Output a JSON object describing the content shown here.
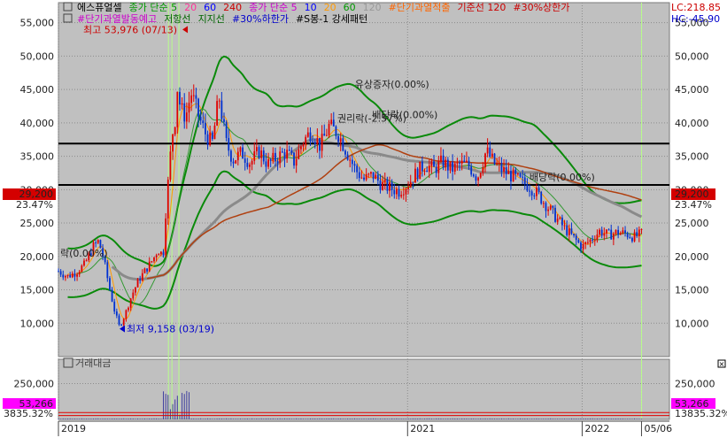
{
  "window": {
    "title": "에스퓨얼셀",
    "colors": {
      "plot_bg": "#c0c0c0",
      "axis_bg": "#ffffff",
      "grid": "#8c8c8c",
      "candle_up": "#e00000",
      "candle_down": "#0030d0"
    }
  },
  "legend": {
    "row1": [
      {
        "text": "에스퓨얼셀",
        "color": "#000000"
      },
      {
        "text": "종가 단순 5",
        "color": "#009900"
      },
      {
        "text": "20",
        "color": "#ff3399"
      },
      {
        "text": "60",
        "color": "#0000ff"
      },
      {
        "text": "240",
        "color": "#cc0000"
      },
      {
        "text": "종가 단순 5",
        "color": "#cc00cc"
      },
      {
        "text": "10",
        "color": "#0000ff"
      },
      {
        "text": "20",
        "color": "#ff9900"
      },
      {
        "text": "60",
        "color": "#009900"
      },
      {
        "text": "120",
        "color": "#999999"
      },
      {
        "text": "#단기과열적출",
        "color": "#ff6600"
      },
      {
        "text": "기준선 120",
        "color": "#cc0000"
      },
      {
        "text": "#30%상한가",
        "color": "#cc0000"
      }
    ],
    "row2": [
      {
        "text": "#단기과열발동예고",
        "color": "#cc00cc"
      },
      {
        "text": "저항선",
        "color": "#006600"
      },
      {
        "text": "지지선",
        "color": "#006600"
      },
      {
        "text": "#30%하한가",
        "color": "#0000cc"
      },
      {
        "text": "#S봉-1 강세패턴",
        "color": "#000000"
      }
    ]
  },
  "right_info": {
    "lc": "LC:218.85",
    "hc": "HC:-45.90"
  },
  "chart_data": {
    "type": "candlestick",
    "price_axis": {
      "ticks": [
        "55,000",
        "50,000",
        "45,000",
        "40,000",
        "35,000",
        "30,000",
        "25,000",
        "20,000",
        "15,000",
        "10,000"
      ],
      "tick_values": [
        55000,
        50000,
        45000,
        40000,
        35000,
        30000,
        25000,
        20000,
        15000,
        10000
      ],
      "ylim": [
        5000,
        58000
      ]
    },
    "current_price": {
      "label": "29,200",
      "value": 29200,
      "pct": "23.47%"
    },
    "horizontal_lines": [
      36900,
      30700
    ],
    "x_axis": {
      "labels": [
        {
          "text": "2019",
          "t": 0.0
        },
        {
          "text": "2021",
          "t": 2.0
        },
        {
          "text": "2022",
          "t": 3.0
        },
        {
          "text": "05/06",
          "t": 3.34
        }
      ],
      "range": [
        0.0,
        3.5
      ]
    },
    "markers": {
      "high": {
        "text": "최고 53,976 (07/13)",
        "value": 53976
      },
      "low": {
        "text": "최저 9,158 (03/19)",
        "value": 9158
      }
    },
    "annotations": [
      {
        "text": "유상증자(0.00%)",
        "t": 1.85,
        "value": 45300
      },
      {
        "text": "배당락(0.00%)",
        "t": 1.95,
        "value": 40700
      },
      {
        "text": "권리락(-2.57%)",
        "t": 1.75,
        "value": 40200
      },
      {
        "text": "배당락(0.00%)",
        "t": 2.85,
        "value": 31400
      },
      {
        "text": "락(0.00%)",
        "t": 0.0,
        "value": 20000
      }
    ],
    "close_series": [
      [
        0.0,
        17800
      ],
      [
        0.05,
        17000
      ],
      [
        0.1,
        17600
      ],
      [
        0.15,
        18800
      ],
      [
        0.2,
        21500
      ],
      [
        0.23,
        22300
      ],
      [
        0.26,
        19500
      ],
      [
        0.29,
        15500
      ],
      [
        0.32,
        12000
      ],
      [
        0.35,
        9400
      ],
      [
        0.38,
        11200
      ],
      [
        0.42,
        14200
      ],
      [
        0.46,
        16500
      ],
      [
        0.5,
        18000
      ],
      [
        0.54,
        19500
      ],
      [
        0.57,
        21000
      ],
      [
        0.6,
        20200
      ],
      [
        0.62,
        29000
      ],
      [
        0.63,
        31500
      ],
      [
        0.65,
        38000
      ],
      [
        0.67,
        40800
      ],
      [
        0.68,
        45500
      ],
      [
        0.7,
        42000
      ],
      [
        0.73,
        41000
      ],
      [
        0.76,
        44500
      ],
      [
        0.8,
        41200
      ],
      [
        0.84,
        38500
      ],
      [
        0.88,
        36800
      ],
      [
        0.92,
        44000
      ],
      [
        0.96,
        37000
      ],
      [
        1.0,
        34500
      ],
      [
        1.05,
        35500
      ],
      [
        1.1,
        34000
      ],
      [
        1.15,
        35800
      ],
      [
        1.2,
        33800
      ],
      [
        1.25,
        34800
      ],
      [
        1.3,
        35600
      ],
      [
        1.35,
        34200
      ],
      [
        1.4,
        37200
      ],
      [
        1.45,
        38800
      ],
      [
        1.5,
        36500
      ],
      [
        1.55,
        39500
      ],
      [
        1.6,
        38500
      ],
      [
        1.65,
        35800
      ],
      [
        1.7,
        33000
      ],
      [
        1.75,
        31500
      ],
      [
        1.8,
        32200
      ],
      [
        1.85,
        30800
      ],
      [
        1.9,
        30200
      ],
      [
        1.95,
        29800
      ],
      [
        2.0,
        30800
      ],
      [
        2.05,
        32500
      ],
      [
        2.1,
        33800
      ],
      [
        2.15,
        33000
      ],
      [
        2.2,
        34200
      ],
      [
        2.25,
        33000
      ],
      [
        2.3,
        33800
      ],
      [
        2.35,
        33600
      ],
      [
        2.4,
        31800
      ],
      [
        2.45,
        35800
      ],
      [
        2.5,
        33800
      ],
      [
        2.55,
        32800
      ],
      [
        2.6,
        32000
      ],
      [
        2.65,
        31200
      ],
      [
        2.7,
        30500
      ],
      [
        2.75,
        29200
      ],
      [
        2.8,
        27500
      ],
      [
        2.85,
        25800
      ],
      [
        2.9,
        24200
      ],
      [
        2.95,
        22800
      ],
      [
        3.0,
        21400
      ],
      [
        3.05,
        22500
      ],
      [
        3.1,
        23800
      ],
      [
        3.15,
        23200
      ],
      [
        3.2,
        23600
      ],
      [
        3.25,
        23400
      ],
      [
        3.3,
        22900
      ],
      [
        3.34,
        23400
      ]
    ],
    "volume_axis": {
      "ticks": [
        "250,000"
      ],
      "tick_values": [
        250000
      ],
      "ylim": [
        0,
        420000
      ]
    },
    "volume_label": "거래대금",
    "volume_readout": {
      "value": "53,266",
      "pct": "3835.32%",
      "pct_right": "13835.32%"
    }
  }
}
